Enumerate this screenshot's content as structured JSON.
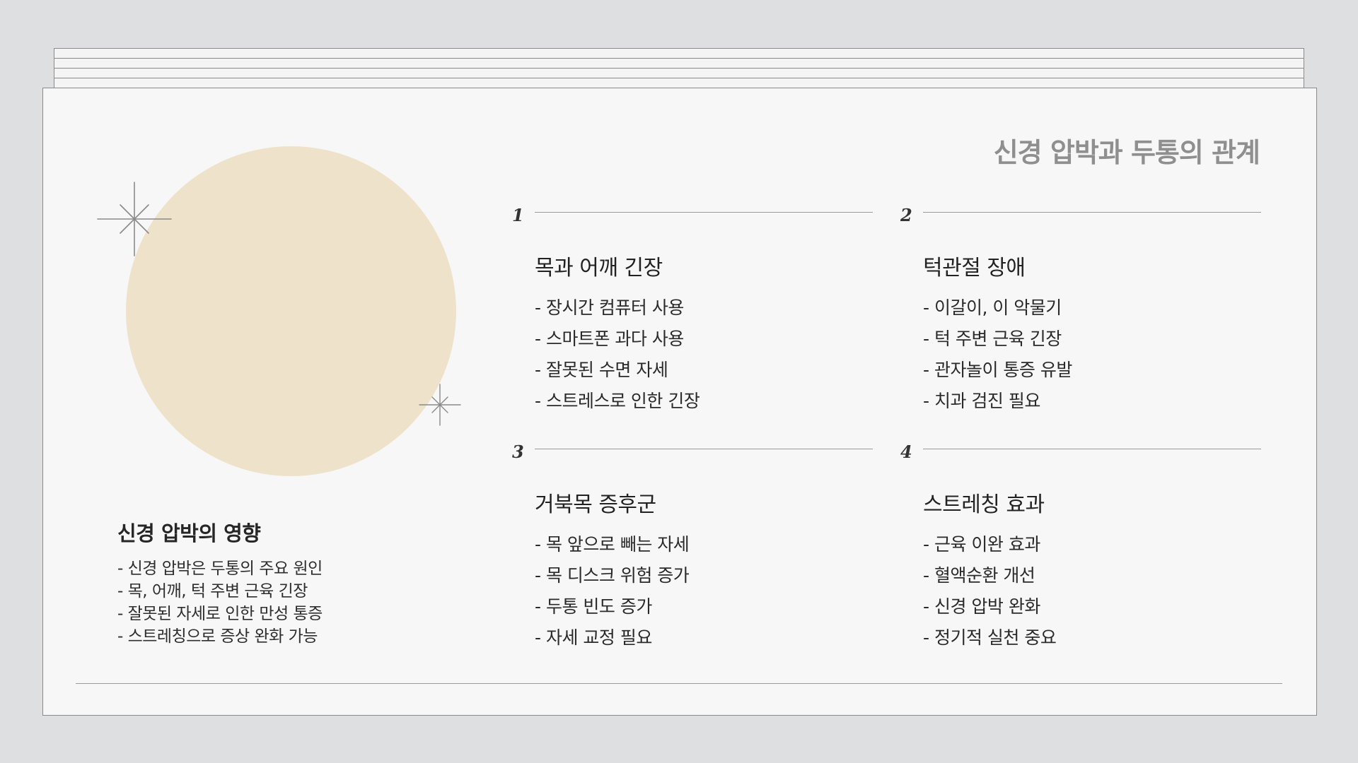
{
  "page_title": "신경 압박과 두통의 관계",
  "left_panel": {
    "title": "신경 압박의 영향",
    "items": [
      "- 신경 압박은 두통의 주요 원인",
      "- 목, 어깨, 턱 주변 근육 긴장",
      "- 잘못된 자세로 인한 만성 통증",
      "- 스트레칭으로 증상 완화 가능"
    ]
  },
  "sections": [
    {
      "number": "1",
      "heading": "목과 어깨 긴장",
      "items": [
        "- 장시간 컴퓨터 사용",
        "- 스마트폰 과다 사용",
        "- 잘못된 수면 자세",
        "- 스트레스로 인한 긴장"
      ]
    },
    {
      "number": "2",
      "heading": "턱관절 장애",
      "items": [
        "- 이갈이, 이 악물기",
        "- 턱 주변 근육 긴장",
        "- 관자놀이 통증 유발",
        "- 치과 검진 필요"
      ]
    },
    {
      "number": "3",
      "heading": "거북목 증후군",
      "items": [
        "- 목 앞으로 빼는 자세",
        "- 목 디스크 위험 증가",
        "- 두통 빈도 증가",
        "- 자세 교정 필요"
      ]
    },
    {
      "number": "4",
      "heading": "스트레칭 효과",
      "items": [
        "- 근육 이완 효과",
        "- 혈액순환 개선",
        "- 신경 압박 완화",
        "- 정기적 실천 중요"
      ]
    }
  ],
  "colors": {
    "background": "#dedfe1",
    "sheet": "#f7f7f7",
    "circle": "#eee3ca",
    "title_gray": "#8f8f8f",
    "rule": "#9a9a9a"
  },
  "icons": [
    "sparkle-icon",
    "sparkle-icon"
  ]
}
